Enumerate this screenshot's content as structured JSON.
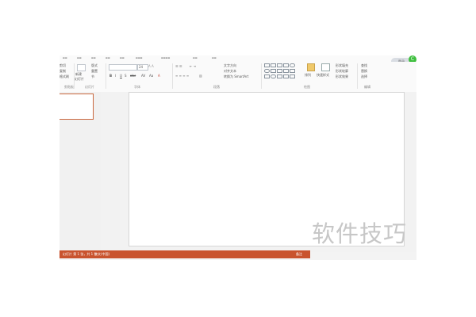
{
  "ribbon": {
    "clipboard_rows": [
      "剪切",
      "复制",
      "格式刷"
    ],
    "new_slide": [
      "新建",
      "幻灯片"
    ],
    "slide_rows": [
      "版式",
      "重置",
      "节"
    ],
    "font_size": "24",
    "text_direction_rows": [
      "文字方向",
      "对齐文本",
      "转换为 SmartArt"
    ],
    "arrange_label": "排列",
    "quick_styles_label": "快速样式",
    "shape_rows": [
      "形状填充",
      "形状轮廓",
      "形状效果"
    ],
    "edit_rows": [
      "查找",
      "替换",
      "选择"
    ],
    "groups": {
      "clipboard": "剪贴板",
      "slides": "幻灯片",
      "font": "字体",
      "paragraph": "段落",
      "drawing": "绘图",
      "editing": "编辑"
    }
  },
  "badge": {
    "login": "登录",
    "status_glyph": "C"
  },
  "status_bar": {
    "slide_counter": "幻灯片 第 1 张，共 1 张",
    "language": "中文(中国)",
    "notes": "备注"
  },
  "watermark": "软件技巧"
}
